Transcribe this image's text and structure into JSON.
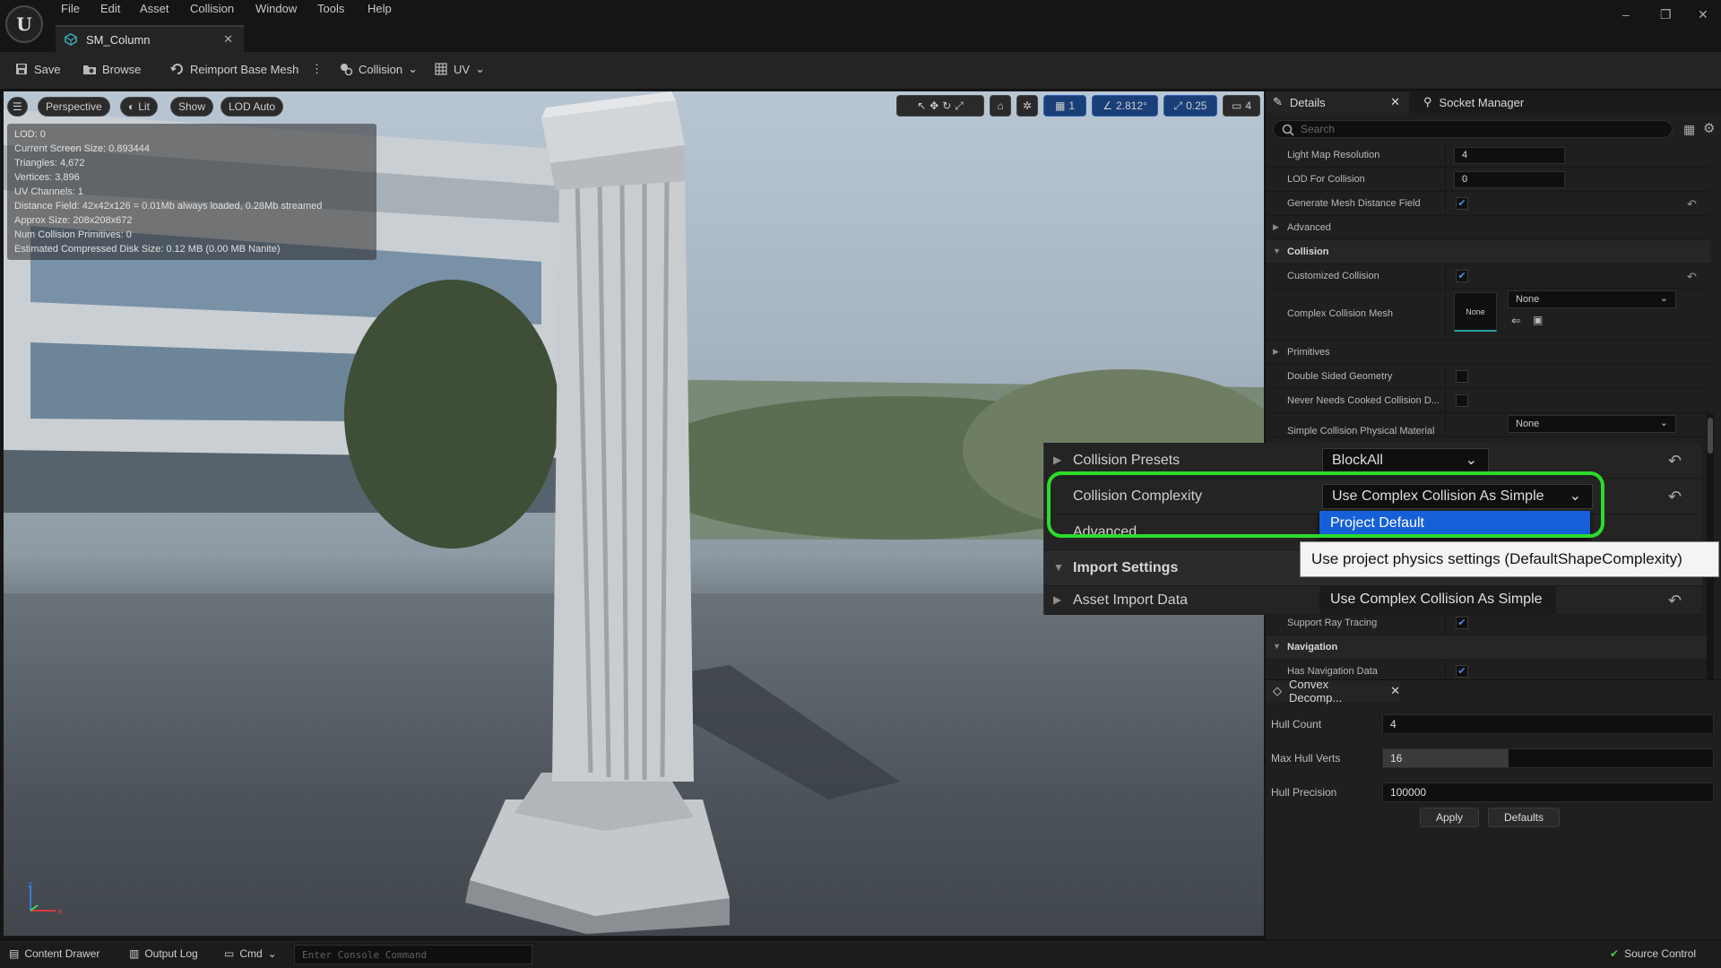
{
  "menu": [
    "File",
    "Edit",
    "Asset",
    "Collision",
    "Window",
    "Tools",
    "Help"
  ],
  "document_tab": {
    "title": "SM_Column",
    "close": "✕"
  },
  "window_controls": {
    "minimize": "–",
    "restore": "❐",
    "close": "✕"
  },
  "toolbar": {
    "save": "Save",
    "browse": "Browse",
    "reimport": "Reimport Base Mesh",
    "more": "⋮",
    "collision": "Collision",
    "uv": "UV"
  },
  "viewport": {
    "perspective": "Perspective",
    "lit": "Lit",
    "show": "Show",
    "lod": "LOD Auto",
    "rotation_snap": "2.812°",
    "scale_snap": "0.25",
    "camera_speed": "4",
    "grid_snap": "1",
    "stats": [
      "LOD:  0",
      "Current Screen Size:  0.893444",
      "Triangles:  4,672",
      "Vertices:  3,896",
      "UV Channels:  1",
      "Distance Field:  42x42x126 = 0.01Mb always loaded, 0.28Mb streamed",
      "Approx Size: 208x208x672",
      "Num Collision Primitives:  0",
      "Estimated Compressed Disk Size: 0.12 MB (0.00 MB Nanite)"
    ]
  },
  "details": {
    "tab": "Details",
    "socket_tab": "Socket Manager",
    "search_placeholder": "Search",
    "light_map_resolution": {
      "label": "Light Map Resolution",
      "value": "4"
    },
    "lod_for_collision": {
      "label": "LOD For Collision",
      "value": "0"
    },
    "generate_distance_field": {
      "label": "Generate Mesh Distance Field",
      "checked": true
    },
    "advanced": "Advanced",
    "collision_section": "Collision",
    "customized_collision": {
      "label": "Customized Collision",
      "checked": true
    },
    "complex_collision_mesh": {
      "label": "Complex Collision Mesh",
      "thumb": "None",
      "value": "None"
    },
    "primitives": "Primitives",
    "double_sided": {
      "label": "Double Sided Geometry",
      "checked": false
    },
    "never_cooked": {
      "label": "Never Needs Cooked Collision D...",
      "checked": false
    },
    "phys_material": {
      "label": "Simple Collision Physical Material",
      "value": "None"
    },
    "support_ray_tracing": {
      "label": "Support Ray Tracing",
      "checked": true
    },
    "navigation_section": "Navigation",
    "has_navigation_data": {
      "label": "Has Navigation Data",
      "checked": true
    }
  },
  "zoom": {
    "collision_presets": {
      "label": "Collision Presets",
      "value": "BlockAll"
    },
    "collision_complexity": {
      "label": "Collision Complexity",
      "value": "Use Complex Collision As Simple"
    },
    "advanced": "Advanced",
    "import_settings": "Import Settings",
    "asset_import_data": "Asset Import Data",
    "dropdown_highlighted": "Project Default",
    "tooltip": "Use project physics settings (DefaultShapeComplexity)",
    "dropdown_option": "Use Complex Collision As Simple"
  },
  "convex": {
    "tab": "Convex Decomp...",
    "hull_count": {
      "label": "Hull Count",
      "value": "4"
    },
    "max_hull_verts": {
      "label": "Max Hull Verts",
      "value": "16"
    },
    "hull_precision": {
      "label": "Hull Precision",
      "value": "100000"
    },
    "apply": "Apply",
    "defaults": "Defaults"
  },
  "statusbar": {
    "content_drawer": "Content Drawer",
    "output_log": "Output Log",
    "cmd": "Cmd",
    "console_placeholder": "Enter Console Command",
    "source_control": "Source Control"
  },
  "colors": {
    "accent": "#1560d8",
    "highlight": "#2bdc2b",
    "panel": "#1f1f1f"
  }
}
